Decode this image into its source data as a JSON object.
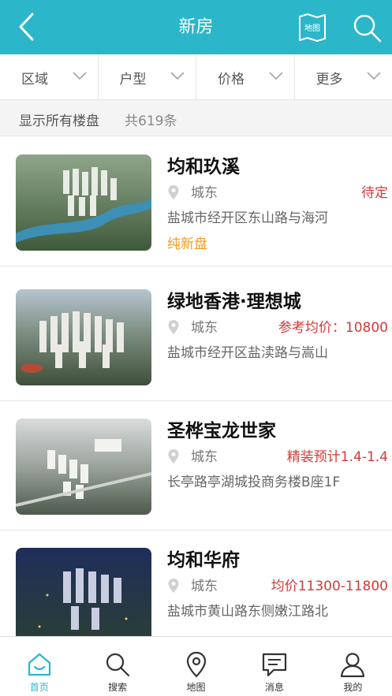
{
  "header": {
    "title": "新房",
    "map_label": "地图",
    "accent": "#2bb6c9"
  },
  "filters": [
    {
      "label": "区域"
    },
    {
      "label": "户型"
    },
    {
      "label": "价格"
    },
    {
      "label": "更多"
    }
  ],
  "summary": {
    "text": "显示所有楼盘",
    "count": "共619条"
  },
  "listings": [
    {
      "name": "均和玖溪",
      "district": "城东",
      "price": "待定",
      "address": "盐城市经开区东山路与海河",
      "tag": "纯新盘"
    },
    {
      "name": "绿地香港·理想城",
      "district": "城东",
      "price": "参考均价：10800",
      "address": "盐城市经开区盐渎路与嵩山",
      "tag": ""
    },
    {
      "name": "圣桦宝龙世家",
      "district": "城东",
      "price": "精装预计1.4-1.4",
      "address": "长亭路亭湖城投商务楼B座1F",
      "tag": ""
    },
    {
      "name": "均和华府",
      "district": "城东",
      "price": "均价11300-11800",
      "address": "盐城市黄山路东侧嫩江路北",
      "tag": ""
    }
  ],
  "tabbar": [
    {
      "label": "首页",
      "icon": "home-icon",
      "active": true
    },
    {
      "label": "搜索",
      "icon": "search-icon",
      "active": false
    },
    {
      "label": "地图",
      "icon": "map-pin-icon",
      "active": false
    },
    {
      "label": "消息",
      "icon": "message-icon",
      "active": false
    },
    {
      "label": "我的",
      "icon": "user-icon",
      "active": false
    }
  ]
}
